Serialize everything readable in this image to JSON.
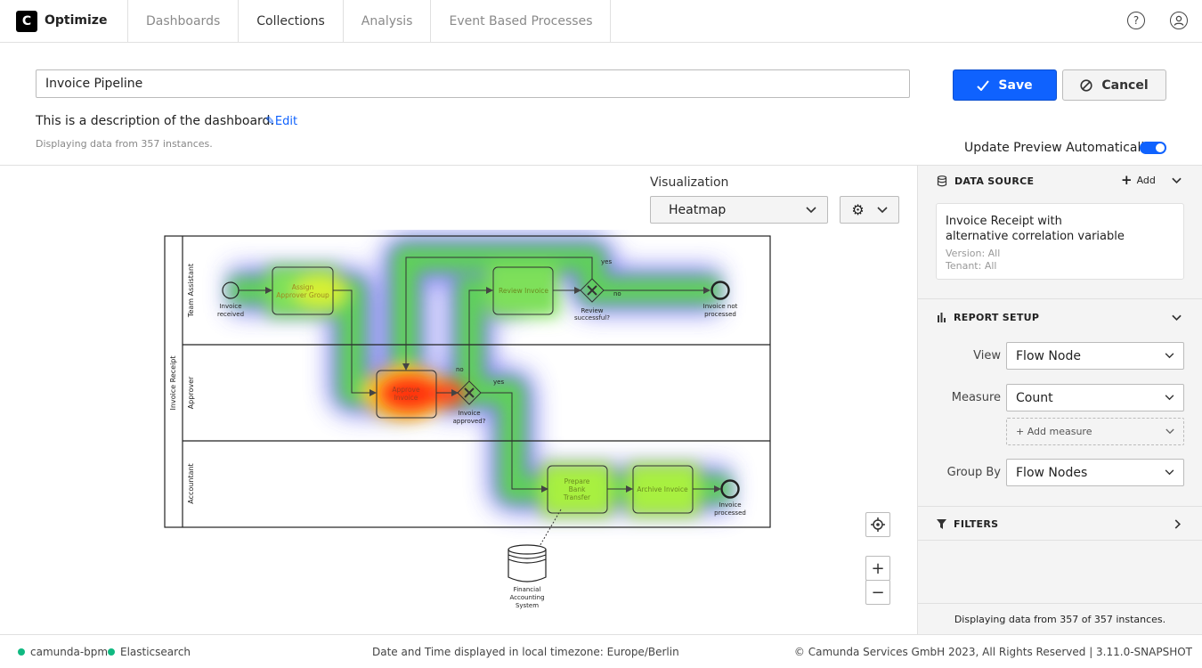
{
  "header": {
    "logo": "C",
    "app_name": "Optimize",
    "nav": [
      "Dashboards",
      "Collections",
      "Analysis",
      "Event Based Processes"
    ]
  },
  "report": {
    "name": "Invoice Pipeline",
    "description": "This is a description of the dashboard.",
    "edit_label": "Edit",
    "instances_text": "Displaying data from 357 instances.",
    "save_label": "Save",
    "cancel_label": "Cancel",
    "update_preview_label": "Update Preview Automatically",
    "update_preview_on": true
  },
  "visualization": {
    "label": "Visualization",
    "selected": "Heatmap"
  },
  "diagram": {
    "pool": "Invoice Receipt",
    "lanes": [
      "Team Assistant",
      "Approver",
      "Accountant"
    ],
    "nodes": {
      "start": [
        "Invoice",
        "received"
      ],
      "assign": [
        "Assign",
        "Approver Group"
      ],
      "review": "Review Invoice",
      "review_gw": [
        "Review",
        "successful?"
      ],
      "not_processed": [
        "Invoice not",
        "processed"
      ],
      "approve": [
        "Approve",
        "Invoice"
      ],
      "approve_gw": [
        "Invoice",
        "approved?"
      ],
      "prepare": [
        "Prepare",
        "Bank",
        "Transfer"
      ],
      "archive": "Archive Invoice",
      "processed": [
        "Invoice",
        "processed"
      ],
      "system": [
        "Financial",
        "Accounting",
        "System"
      ]
    },
    "flow_labels": {
      "yes": "yes",
      "no": "no"
    }
  },
  "panel": {
    "data_source": {
      "heading": "DATA SOURCE",
      "add_label": "Add",
      "title_line1": "Invoice Receipt with",
      "title_line2": "alternative correlation variable",
      "version": "Version: All",
      "tenant": "Tenant: All"
    },
    "report_setup": {
      "heading": "REPORT SETUP",
      "view_label": "View",
      "view_value": "Flow Node",
      "measure_label": "Measure",
      "measure_value": "Count",
      "add_measure": "+ Add measure",
      "group_label": "Group By",
      "group_value": "Flow Nodes"
    },
    "filters_heading": "FILTERS",
    "footer": "Displaying data from 357 of 357 instances."
  },
  "footer": {
    "status": [
      "camunda-bpm",
      "Elasticsearch"
    ],
    "status_color": "#10b981",
    "timezone": "Date and Time displayed in local timezone: Europe/Berlin",
    "copyright": "© Camunda Services GmbH 2023, All Rights Reserved | 3.11.0-SNAPSHOT"
  },
  "colors": {
    "accent": "#0f62fe"
  }
}
